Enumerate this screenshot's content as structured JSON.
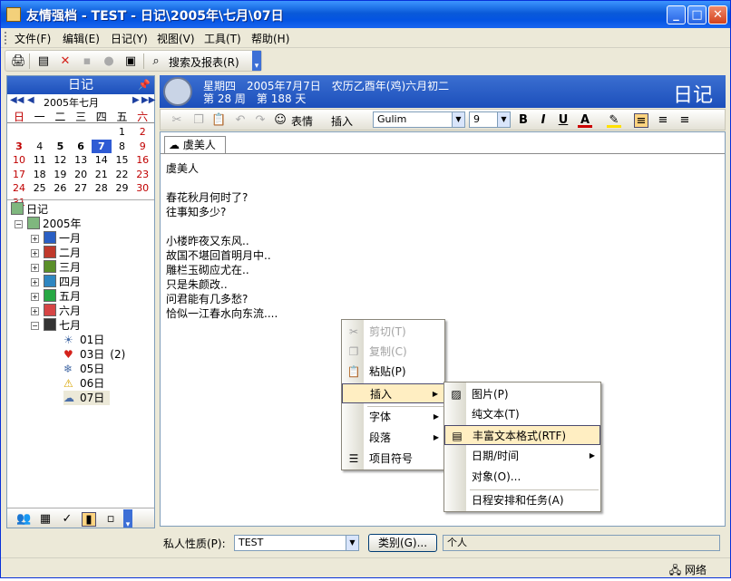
{
  "window": {
    "title": "友情强档 - TEST - 日记\\2005年\\七月\\07日"
  },
  "menu": [
    "文件(F)",
    "编辑(E)",
    "日记(Y)",
    "视图(V)",
    "工具(T)",
    "帮助(H)"
  ],
  "toolbar": {
    "report_label": "搜索及报表(R)"
  },
  "leftpane": {
    "title": "日记",
    "month_label": "2005年七月",
    "weekdays": [
      "日",
      "一",
      "二",
      "三",
      "四",
      "五",
      "六"
    ],
    "days": [
      [
        "",
        "",
        "",
        "",
        "",
        "1",
        "2"
      ],
      [
        "3",
        "4",
        "5",
        "6",
        "7",
        "8",
        "9"
      ],
      [
        "10",
        "11",
        "12",
        "13",
        "14",
        "15",
        "16"
      ],
      [
        "17",
        "18",
        "19",
        "20",
        "21",
        "22",
        "23"
      ],
      [
        "24",
        "25",
        "26",
        "27",
        "28",
        "29",
        "30"
      ],
      [
        "31",
        "",
        "",
        "",
        "",
        "",
        ""
      ]
    ],
    "selected_day": "7",
    "tree": {
      "root": "日记",
      "year": "2005年",
      "months": [
        "一月",
        "二月",
        "三月",
        "四月",
        "五月",
        "六月",
        "七月"
      ],
      "days": [
        {
          "label": "01日",
          "count": ""
        },
        {
          "label": "03日",
          "count": "(2)"
        },
        {
          "label": "05日",
          "count": ""
        },
        {
          "label": "06日",
          "count": ""
        },
        {
          "label": "07日",
          "count": ""
        }
      ]
    }
  },
  "header": {
    "line1": "星期四　2005年7月7日　农历乙酉年(鸡)六月初二",
    "line2": "第 28 周　第 188 天",
    "big_title": "日记"
  },
  "format": {
    "emoji_label": "表情",
    "insert_label": "插入",
    "font": "Gulim",
    "size": "9"
  },
  "editor": {
    "tab": "虞美人",
    "content": "虞美人\n\n春花秋月何时了?\n往事知多少?\n\n小楼昨夜又东风..\n故国不堪回首明月中..\n雕栏玉砌应尤在..\n只是朱颜改..\n问君能有几多愁?\n恰似一江春水向东流...."
  },
  "bottom": {
    "privacy_label": "私人性质(P):",
    "privacy_value": "TEST",
    "category_button": "类别(G)...",
    "category_value": "个人"
  },
  "status": {
    "network": "网络"
  },
  "context_menu": {
    "items": [
      "剪切(T)",
      "复制(C)",
      "粘贴(P)",
      "插入",
      "字体",
      "段落",
      "项目符号"
    ],
    "submenu": [
      "图片(P)",
      "纯文本(T)",
      "丰富文本格式(RTF)",
      "日期/时间",
      "对象(O)...",
      "日程安排和任务(A)"
    ]
  },
  "colors": {
    "accent": "#1c4fbb",
    "selected": "#2f5bd4",
    "highlight": "#ffeec2",
    "weekend": "#c00000"
  }
}
